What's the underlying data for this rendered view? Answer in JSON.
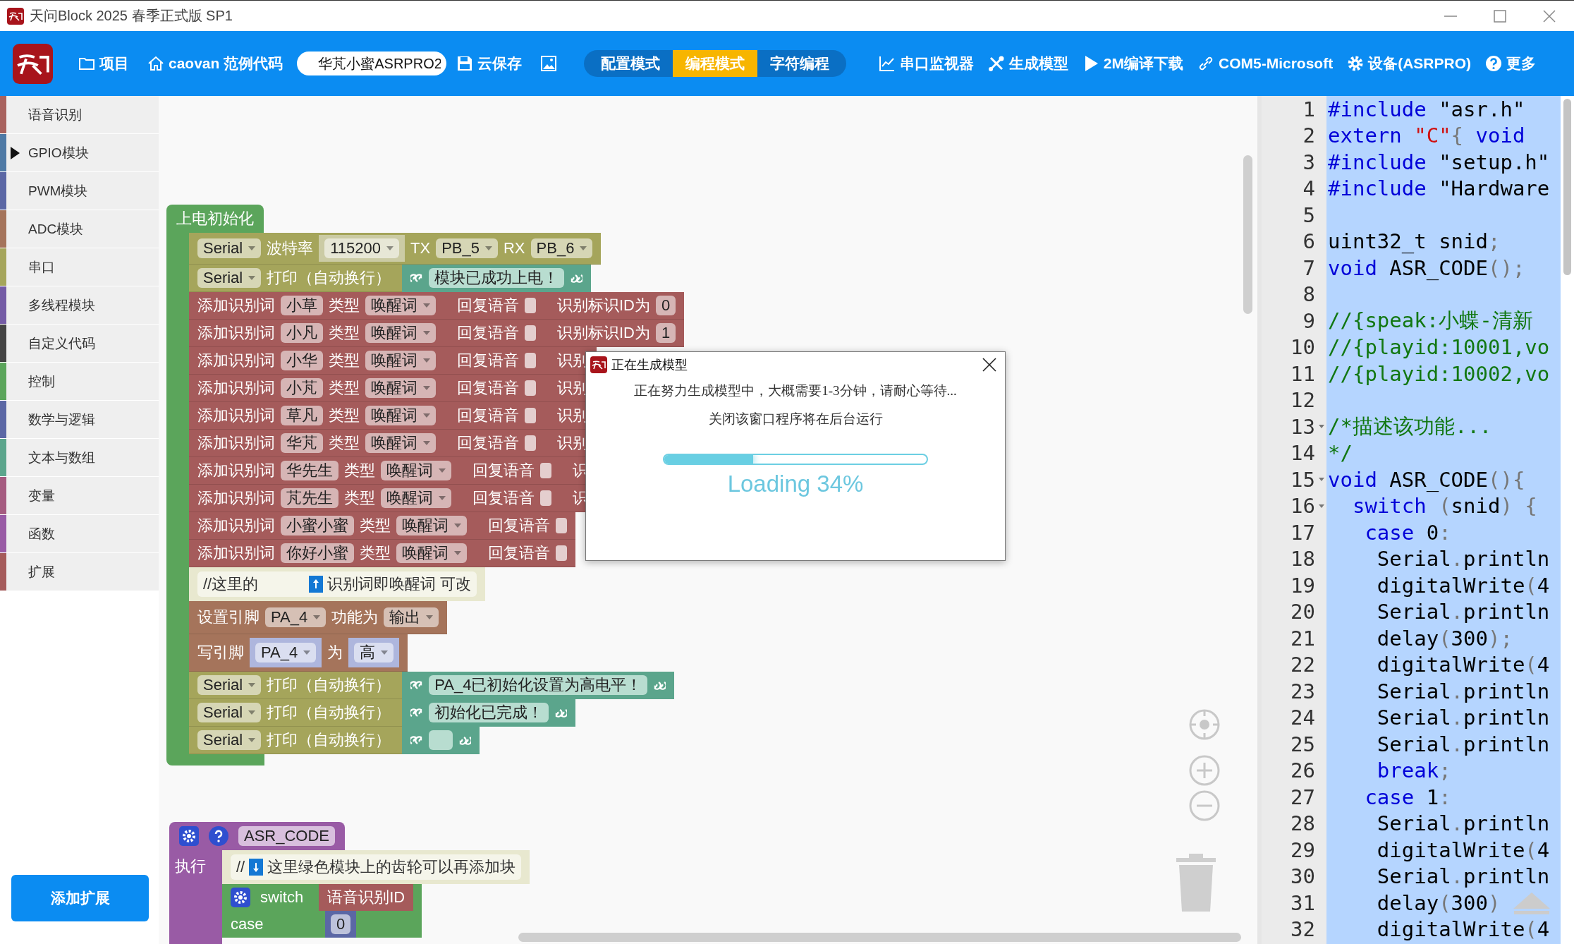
{
  "window": {
    "title": "天问Block 2025 春季正式版 SP1"
  },
  "toolbar": {
    "nav": [
      {
        "label": "项目"
      },
      {
        "label": "caovan 范例代码"
      }
    ],
    "project_field": {
      "value": "华芃小蜜ASRPRO2"
    },
    "save": {
      "label": "云保存"
    },
    "modes": [
      {
        "label": "配置模式",
        "selected": false
      },
      {
        "label": "编程模式",
        "selected": true
      },
      {
        "label": "字符编程",
        "selected": false
      }
    ],
    "actions": [
      {
        "label": "串口监视器"
      },
      {
        "label": "生成模型"
      },
      {
        "label": "2M编译下载"
      },
      {
        "label": "COM5-Microsoft"
      },
      {
        "label": "设备(ASRPRO)"
      },
      {
        "label": "更多"
      }
    ]
  },
  "sidebar": {
    "categories": [
      {
        "label": "语音识别",
        "color": "#a8625e",
        "selected": false
      },
      {
        "label": "GPIO模块",
        "color": "#4f7aa6",
        "selected": true
      },
      {
        "label": "PWM模块",
        "color": "#5b67a5",
        "selected": false
      },
      {
        "label": "ADC模块",
        "color": "#a5745b",
        "selected": false
      },
      {
        "label": "串口",
        "color": "#a5a55b",
        "selected": false
      },
      {
        "label": "多线程模块",
        "color": "#745ba5",
        "selected": false
      },
      {
        "label": "自定义代码",
        "color": "#444444",
        "selected": false
      },
      {
        "label": "控制",
        "color": "#5ba55b",
        "selected": false
      },
      {
        "label": "数学与逻辑",
        "color": "#5b67a5",
        "selected": false
      },
      {
        "label": "文本与数组",
        "color": "#5ba58c",
        "selected": false
      },
      {
        "label": "变量",
        "color": "#a55b80",
        "selected": false
      },
      {
        "label": "函数",
        "color": "#995ba5",
        "selected": false
      },
      {
        "label": "扩展",
        "color": "#a55b5b",
        "selected": false
      }
    ],
    "add_button": "添加扩展"
  },
  "workspace": {
    "stacks": [
      {
        "kind": "event",
        "title": "上电初始化",
        "blocks": [
          {
            "kind": "serial_begin",
            "port": "Serial",
            "baud_label": "波特率",
            "baud": "115200",
            "tx_label": "TX",
            "tx": "PB_5",
            "rx_label": "RX",
            "rx": "PB_6"
          },
          {
            "kind": "serial_print",
            "port": "Serial",
            "label": "打印（自动换行）",
            "text": "模块已成功上电！"
          },
          {
            "kind": "add_word",
            "label": "添加识别词",
            "word": "小草",
            "type_label": "类型",
            "type": "唤醒词",
            "reply_label": "回复语音",
            "reply": false,
            "id_label": "识别标识ID为",
            "id": "0"
          },
          {
            "kind": "add_word",
            "label": "添加识别词",
            "word": "小凡",
            "type_label": "类型",
            "type": "唤醒词",
            "reply_label": "回复语音",
            "reply": false,
            "id_label": "识别标识ID为",
            "id": "1"
          },
          {
            "kind": "add_word",
            "label": "添加识别词",
            "word": "小华",
            "type_label": "类型",
            "type": "唤醒词",
            "reply_label": "回复语音",
            "reply": false,
            "id_label": "识别"
          },
          {
            "kind": "add_word",
            "label": "添加识别词",
            "word": "小芃",
            "type_label": "类型",
            "type": "唤醒词",
            "reply_label": "回复语音",
            "reply": false,
            "id_label": "识别"
          },
          {
            "kind": "add_word",
            "label": "添加识别词",
            "word": "草凡",
            "type_label": "类型",
            "type": "唤醒词",
            "reply_label": "回复语音",
            "reply": false,
            "id_label": "识别"
          },
          {
            "kind": "add_word",
            "label": "添加识别词",
            "word": "华芃",
            "type_label": "类型",
            "type": "唤醒词",
            "reply_label": "回复语音",
            "reply": false,
            "id_label": "识别"
          },
          {
            "kind": "add_word",
            "label": "添加识别词",
            "word": "华先生",
            "type_label": "类型",
            "type": "唤醒词",
            "reply_label": "回复语音",
            "reply": false,
            "id_label": "识"
          },
          {
            "kind": "add_word",
            "label": "添加识别词",
            "word": "芃先生",
            "type_label": "类型",
            "type": "唤醒词",
            "reply_label": "回复语音",
            "reply": false,
            "id_label": "识"
          },
          {
            "kind": "add_word",
            "label": "添加识别词",
            "word": "小蜜小蜜",
            "type_label": "类型",
            "type": "唤醒词",
            "reply_label": "回复语音",
            "reply": false
          },
          {
            "kind": "add_word",
            "label": "添加识别词",
            "word": "你好小蜜",
            "type_label": "类型",
            "type": "唤醒词",
            "reply_label": "回复语音",
            "reply": false
          },
          {
            "kind": "comment",
            "before": "//这里的",
            "after": "识别词即唤醒词 可改"
          },
          {
            "kind": "pin_mode",
            "label": "设置引脚",
            "pin": "PA_4",
            "mode_label": "功能为",
            "mode": "输出"
          },
          {
            "kind": "digital_write",
            "label": "写引脚",
            "pin": "PA_4",
            "value_label": "为",
            "value": "高"
          },
          {
            "kind": "serial_print",
            "port": "Serial",
            "label": "打印（自动换行）",
            "text": "PA_4已初始化设置为高电平！"
          },
          {
            "kind": "serial_print",
            "port": "Serial",
            "label": "打印（自动换行）",
            "text": "初始化已完成！"
          },
          {
            "kind": "serial_print",
            "port": "Serial",
            "label": "打印（自动换行）"
          }
        ]
      },
      {
        "kind": "function",
        "name": "ASR_CODE",
        "body_label": "执行",
        "blocks": [
          {
            "kind": "comment",
            "before": "//",
            "after": "这里绿色模块上的齿轮可以再添加块"
          },
          {
            "kind": "switch",
            "label": "switch",
            "value": "语音识别ID",
            "case_label": "case",
            "case_value": "0"
          }
        ]
      }
    ]
  },
  "code_editor": {
    "lines": [
      {
        "number": "1",
        "tokens": [
          {
            "kind": "keyword",
            "text": "#include"
          },
          {
            "kind": "text",
            "text": " \"asr.h\""
          }
        ]
      },
      {
        "number": "2",
        "tokens": [
          {
            "kind": "keyword",
            "text": "extern "
          },
          {
            "kind": "string",
            "text": "\"C\""
          },
          {
            "kind": "punctuation",
            "text": "{"
          },
          {
            "kind": "keyword",
            "text": " void"
          }
        ]
      },
      {
        "number": "3",
        "tokens": [
          {
            "kind": "keyword",
            "text": "#include"
          },
          {
            "kind": "text",
            "text": " \"setup.h\""
          }
        ]
      },
      {
        "number": "4",
        "tokens": [
          {
            "kind": "keyword",
            "text": "#include"
          },
          {
            "kind": "text",
            "text": " \"Hardware"
          }
        ]
      },
      {
        "number": "5"
      },
      {
        "number": "6",
        "tokens": [
          {
            "kind": "text",
            "text": "uint32_t snid"
          },
          {
            "kind": "punctuation",
            "text": ";"
          }
        ]
      },
      {
        "number": "7",
        "tokens": [
          {
            "kind": "keyword",
            "text": "void"
          },
          {
            "kind": "text",
            "text": " ASR_CODE"
          },
          {
            "kind": "punctuation",
            "text": "();"
          }
        ]
      },
      {
        "number": "8"
      },
      {
        "number": "9",
        "tokens": [
          {
            "kind": "comment",
            "text": "//{speak:小蝶-清新"
          }
        ]
      },
      {
        "number": "10",
        "tokens": [
          {
            "kind": "comment",
            "text": "//{playid:10001,vo"
          }
        ]
      },
      {
        "number": "11",
        "tokens": [
          {
            "kind": "comment",
            "text": "//{playid:10002,vo"
          }
        ]
      },
      {
        "number": "12"
      },
      {
        "number": "13",
        "fold": true,
        "tokens": [
          {
            "kind": "comment",
            "text": "/*描述该功能..."
          }
        ]
      },
      {
        "number": "14",
        "tokens": [
          {
            "kind": "comment",
            "text": "*/"
          }
        ]
      },
      {
        "number": "15",
        "fold": true,
        "tokens": [
          {
            "kind": "keyword",
            "text": "void"
          },
          {
            "kind": "text",
            "text": " ASR_CODE"
          },
          {
            "kind": "punctuation",
            "text": "(){"
          }
        ]
      },
      {
        "number": "16",
        "fold": true,
        "tokens": [
          {
            "kind": "keyword",
            "text": "  switch"
          },
          {
            "kind": "punctuation",
            "text": " ("
          },
          {
            "kind": "text",
            "text": "snid"
          },
          {
            "kind": "punctuation",
            "text": ") {"
          }
        ]
      },
      {
        "number": "17",
        "tokens": [
          {
            "kind": "keyword",
            "text": "   case"
          },
          {
            "kind": "text",
            "text": " 0"
          },
          {
            "kind": "punctuation",
            "text": ":"
          }
        ]
      },
      {
        "number": "18",
        "tokens": [
          {
            "kind": "text",
            "text": "    Serial"
          },
          {
            "kind": "punctuation",
            "text": "."
          },
          {
            "kind": "text",
            "text": "println"
          }
        ]
      },
      {
        "number": "19",
        "tokens": [
          {
            "kind": "text",
            "text": "    digitalWrite"
          },
          {
            "kind": "punctuation",
            "text": "("
          },
          {
            "kind": "text",
            "text": "4"
          }
        ]
      },
      {
        "number": "20",
        "tokens": [
          {
            "kind": "text",
            "text": "    Serial"
          },
          {
            "kind": "punctuation",
            "text": "."
          },
          {
            "kind": "text",
            "text": "println"
          }
        ]
      },
      {
        "number": "21",
        "tokens": [
          {
            "kind": "text",
            "text": "    delay"
          },
          {
            "kind": "punctuation",
            "text": "("
          },
          {
            "kind": "text",
            "text": "300"
          },
          {
            "kind": "punctuation",
            "text": ");"
          }
        ]
      },
      {
        "number": "22",
        "tokens": [
          {
            "kind": "text",
            "text": "    digitalWrite"
          },
          {
            "kind": "punctuation",
            "text": "("
          },
          {
            "kind": "text",
            "text": "4"
          }
        ]
      },
      {
        "number": "23",
        "tokens": [
          {
            "kind": "text",
            "text": "    Serial"
          },
          {
            "kind": "punctuation",
            "text": "."
          },
          {
            "kind": "text",
            "text": "println"
          }
        ]
      },
      {
        "number": "24",
        "tokens": [
          {
            "kind": "text",
            "text": "    Serial"
          },
          {
            "kind": "punctuation",
            "text": "."
          },
          {
            "kind": "text",
            "text": "println"
          }
        ]
      },
      {
        "number": "25",
        "tokens": [
          {
            "kind": "text",
            "text": "    Serial"
          },
          {
            "kind": "punctuation",
            "text": "."
          },
          {
            "kind": "text",
            "text": "println"
          }
        ]
      },
      {
        "number": "26",
        "tokens": [
          {
            "kind": "keyword",
            "text": "    break"
          },
          {
            "kind": "punctuation",
            "text": ";"
          }
        ]
      },
      {
        "number": "27",
        "tokens": [
          {
            "kind": "keyword",
            "text": "   case"
          },
          {
            "kind": "text",
            "text": " 1"
          },
          {
            "kind": "punctuation",
            "text": ":"
          }
        ]
      },
      {
        "number": "28",
        "tokens": [
          {
            "kind": "text",
            "text": "    Serial"
          },
          {
            "kind": "punctuation",
            "text": "."
          },
          {
            "kind": "text",
            "text": "println"
          }
        ]
      },
      {
        "number": "29",
        "tokens": [
          {
            "kind": "text",
            "text": "    digitalWrite"
          },
          {
            "kind": "punctuation",
            "text": "("
          },
          {
            "kind": "text",
            "text": "4"
          }
        ]
      },
      {
        "number": "30",
        "tokens": [
          {
            "kind": "text",
            "text": "    Serial"
          },
          {
            "kind": "punctuation",
            "text": "."
          },
          {
            "kind": "text",
            "text": "println"
          }
        ]
      },
      {
        "number": "31",
        "tokens": [
          {
            "kind": "text",
            "text": "    delay"
          },
          {
            "kind": "punctuation",
            "text": "("
          },
          {
            "kind": "text",
            "text": "300"
          },
          {
            "kind": "punctuation",
            "text": ")"
          }
        ]
      },
      {
        "number": "32",
        "tokens": [
          {
            "kind": "text",
            "text": "    digitalWrite"
          },
          {
            "kind": "punctuation",
            "text": "("
          },
          {
            "kind": "text",
            "text": "4"
          }
        ]
      }
    ]
  },
  "dialog": {
    "title": "正在生成模型",
    "message": "正在努力生成模型中，大概需要1-3分钟，请耐心等待...",
    "note": "关闭该窗口程序将在后台运行",
    "progress": {
      "level": 0.34
    },
    "progress_text": "Loading 34%"
  }
}
